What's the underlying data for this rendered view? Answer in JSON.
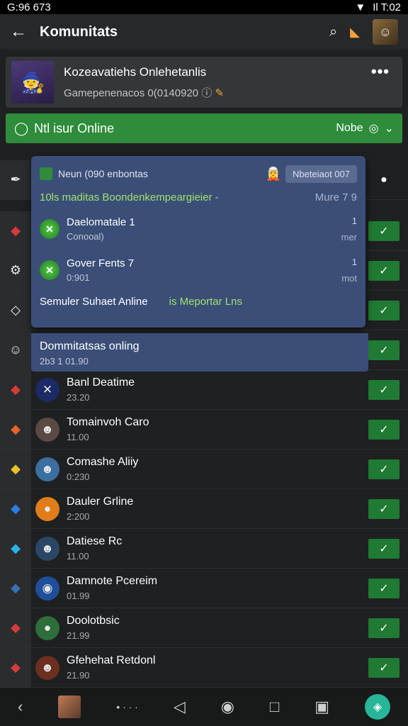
{
  "status_bar": {
    "time": "G:96 673",
    "right_time": "Il T:02"
  },
  "appbar": {
    "title": "Komunitats"
  },
  "group": {
    "title": "Kozeavatiehs Onlehetanlis",
    "subtitle": "Gamepenenacos 0(0140920"
  },
  "online_bar": {
    "label": "Ntl isur Online",
    "right_label": "Nobe"
  },
  "popup": {
    "header_label": "Neun (090 enbontas",
    "header_pill": "Nbeteiaot 007",
    "subtitle": "10ls maditas Boondenkempeargieier -",
    "more": "Mure 7 9",
    "items": [
      {
        "title": "Daelomatale",
        "count": "1",
        "sub": "Conooal)",
        "meta1": "1",
        "meta2": "mer"
      },
      {
        "title": "Gover Fents",
        "count": "7",
        "sub": "0:901",
        "meta1": "1",
        "meta2": "mot"
      }
    ],
    "footer_a": "Semuler Suhaet Anline",
    "footer_b": "is Meportar Lns"
  },
  "highlight_row": {
    "name": "Dommitatsas onling",
    "sub": "2b3 1 01.90"
  },
  "rows": [
    {
      "name": "Banl Deatime",
      "sub": "23.20",
      "lead": "◆",
      "lead_color": "#d43b3b",
      "icon_bg": "#1c2a66",
      "icon": "✕"
    },
    {
      "name": "Tomainvoh Caro",
      "sub": "11.00",
      "lead": "◆",
      "lead_color": "#e8632b",
      "icon_bg": "#5b4a44",
      "icon": "☻"
    },
    {
      "name": "Comashe Aliiy",
      "sub": "0:230",
      "lead": "◆",
      "lead_color": "#e8c12b",
      "icon_bg": "#3a6fa0",
      "icon": "☻"
    },
    {
      "name": "Dauler Grline",
      "sub": "2:200",
      "lead": "◆",
      "lead_color": "#2b7ee8",
      "icon_bg": "#e07d1a",
      "icon": "●"
    },
    {
      "name": "Datiese Rc",
      "sub": "11.00",
      "lead": "◆",
      "lead_color": "#2bb2e8",
      "icon_bg": "#2a4766",
      "icon": "☻"
    },
    {
      "name": "Damnote Pcereim",
      "sub": "01.99",
      "lead": "◆",
      "lead_color": "#3a6fb4",
      "icon_bg": "#1f4f9a",
      "icon": "◉"
    },
    {
      "name": "Doolotbsic",
      "sub": "21.99",
      "lead": "◆",
      "lead_color": "#d43b3b",
      "icon_bg": "#2d6e3a",
      "icon": "●"
    },
    {
      "name": "Gfehehat Retdonl",
      "sub": "21.90",
      "lead": "◆",
      "lead_color": "#d43b3b",
      "icon_bg": "#6b3020",
      "icon": "☻"
    }
  ]
}
